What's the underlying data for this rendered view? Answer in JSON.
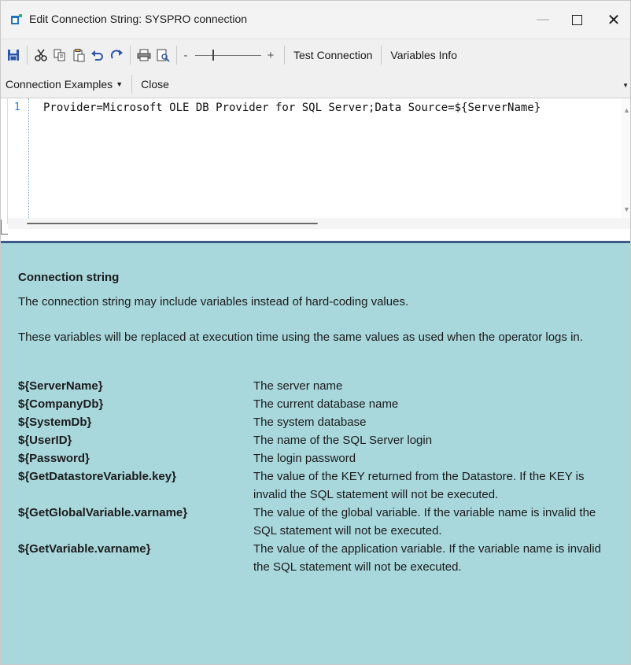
{
  "window": {
    "title": "Edit Connection String: SYSPRO connection",
    "minimize_glyph": "—",
    "close_glyph": "✕"
  },
  "toolbar": {
    "icons": [
      "save-icon",
      "cut-icon",
      "copy-icon",
      "paste-icon",
      "undo-icon",
      "redo-icon",
      "print-icon",
      "print-preview-icon"
    ],
    "zoom_minus": "-",
    "zoom_plus": "+",
    "test_connection": "Test Connection",
    "variables_info": "Variables Info"
  },
  "toolbar2": {
    "connection_examples": "Connection Examples",
    "close": "Close"
  },
  "editor": {
    "line_number": "1",
    "code": "Provider=Microsoft OLE DB Provider for SQL Server;Data Source=${ServerName}"
  },
  "help": {
    "heading": "Connection string",
    "paragraph1": "The connection string may include variables instead of hard-coding values.",
    "paragraph2": "These variables will be replaced at execution time using the same values as used when the operator logs in.",
    "variables": [
      {
        "name": "${ServerName}",
        "description": "The server name"
      },
      {
        "name": "${CompanyDb}",
        "description": "The current database name"
      },
      {
        "name": "${SystemDb}",
        "description": "The system database"
      },
      {
        "name": "${UserID}",
        "description": "The name of the SQL Server login"
      },
      {
        "name": "${Password}",
        "description": "The login password"
      },
      {
        "name": "${GetDatastoreVariable.key}",
        "description": "The value of the KEY returned from the Datastore. If the KEY is invalid the SQL statement will not be executed."
      },
      {
        "name": "${GetGlobalVariable.varname}",
        "description": "The value of the global variable. If the variable name is invalid the SQL statement will not be executed."
      },
      {
        "name": "${GetVariable.varname}",
        "description": "The value of the application variable. If the variable name is invalid the SQL statement will not be executed."
      }
    ]
  },
  "colors": {
    "help_background": "#a8d7dc",
    "splitter": "#3b5b86",
    "line_number": "#2b7bd6"
  }
}
